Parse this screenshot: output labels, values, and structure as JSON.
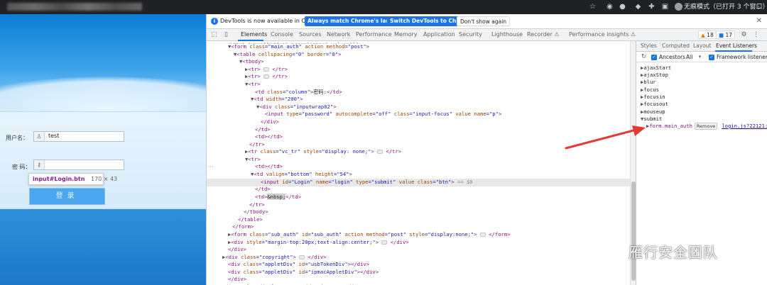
{
  "browser": {
    "incognito_label": "无痕模式（已打开 3 个窗口）"
  },
  "login_page": {
    "username_label": "用户名：",
    "username_value": "test",
    "password_label": "密  码：",
    "login_button_label": "登录",
    "tooltip_selector": "input#Login.btn",
    "tooltip_dims": "170 × 43"
  },
  "infobar": {
    "message": "DevTools is now available in Chinese!",
    "btn_match": "Always match Chrome's language",
    "btn_switch": "Switch DevTools to Chinese",
    "btn_dont_show": "Don't show again"
  },
  "tabs": [
    "Elements",
    "Console",
    "Sources",
    "Network",
    "Performance",
    "Memory",
    "Application",
    "Security",
    "Lighthouse",
    "Recorder ⚠",
    "Performance insights ⚠"
  ],
  "badges": {
    "warnings": "18",
    "messages": "17"
  },
  "sidebar": {
    "tabs": [
      "Styles",
      "Computed",
      "Layout",
      "Event Listeners"
    ],
    "ancestors_label": "Ancestors",
    "ancestors_value": "All",
    "framework_label": "Framework listeners",
    "events": [
      "ajaxStart",
      "ajaxStop",
      "blur",
      "focus",
      "focusin",
      "focusout",
      "mouseup",
      "submit"
    ],
    "listener_node": "form.main_auth",
    "remove_label": "Remove",
    "listener_link": "login.js?22121:185"
  },
  "watermark": {
    "text": "雁行安全团队"
  },
  "colors": {
    "accent": "#1a73e8",
    "arrow": "#e53935",
    "tag": "#881280",
    "attr_name": "#994500",
    "attr_value": "#1a1aa6"
  }
}
